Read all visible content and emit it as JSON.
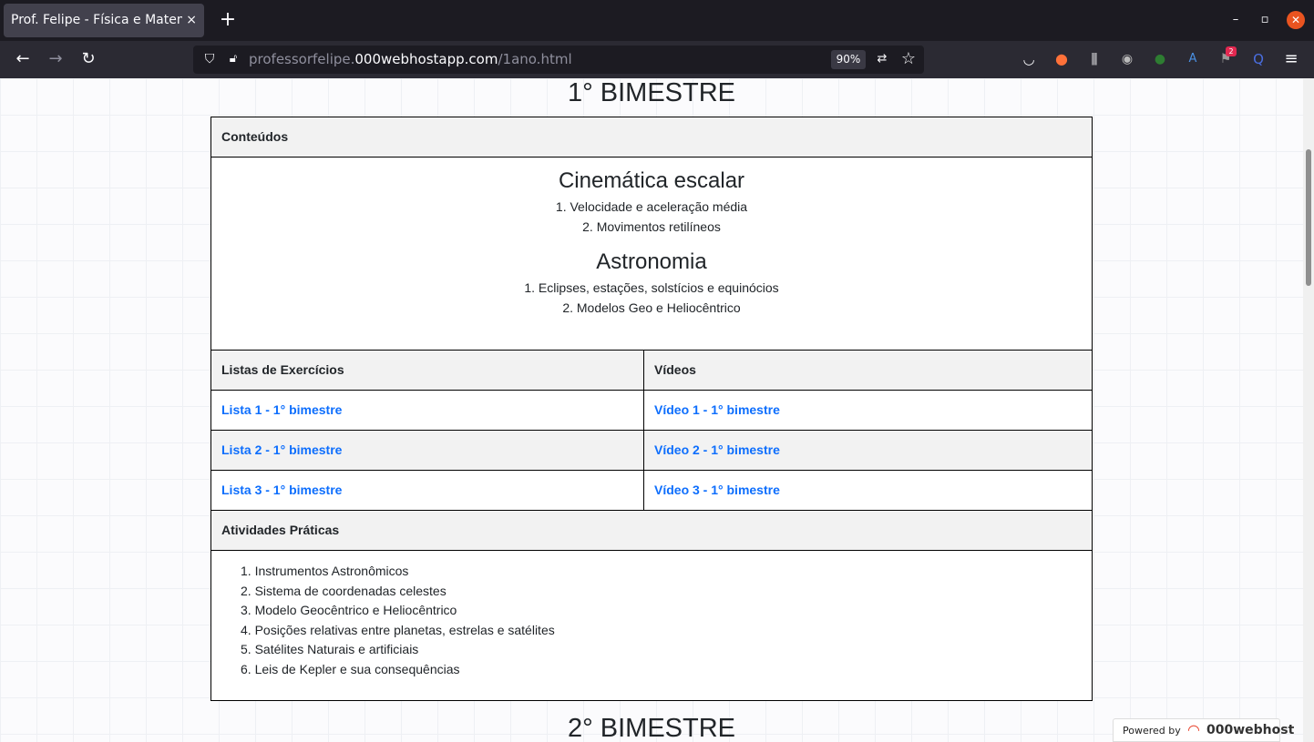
{
  "browser": {
    "tab_title": "Prof. Felipe - Física e Matemática",
    "tab_close": "×",
    "new_tab": "+",
    "window_controls": {
      "minimize": "–",
      "maximize": "▫",
      "close": "✕"
    },
    "url_scheme": "professorfelipe.",
    "url_host": "000webhostapp.com",
    "url_path": "/1ano.html",
    "zoom": "90%",
    "notification_badge": "2"
  },
  "page": {
    "bimester1_title": "1° BIMESTRE",
    "contents_header": "Conteúdos",
    "topic1_title": "Cinemática escalar",
    "topic1_items": [
      "1. Velocidade e aceleração média",
      "2. Movimentos retilíneos"
    ],
    "topic2_title": "Astronomia",
    "topic2_items": [
      "1. Eclipses, estações, solstícios e equinócios",
      "2. Modelos Geo e Heliocêntrico"
    ],
    "lists_header": "Listas de Exercícios",
    "videos_header": "Vídeos",
    "lists": [
      "Lista 1 - 1° bimestre",
      "Lista 2 - 1° bimestre",
      "Lista 3 - 1° bimestre"
    ],
    "videos": [
      "Vídeo 1 - 1° bimestre",
      "Vídeo 2 - 1° bimestre",
      "Vídeo 3 - 1° bimestre"
    ],
    "practical_header": "Atividades Práticas",
    "practical_items": [
      "1. Instrumentos Astronômicos",
      "2. Sistema de coordenadas celestes",
      "3. Modelo Geocêntrico e Heliocêntrico",
      "4. Posições relativas entre planetas, estrelas e satélites",
      "5. Satélites Naturais e artificiais",
      "6. Leis de Kepler e sua consequências"
    ],
    "bimester2_title": "2° BIMESTRE"
  },
  "footer": {
    "powered_by": "Powered by",
    "brand": "000webhost"
  },
  "icons": {
    "back": "back-arrow-icon",
    "forward": "forward-arrow-icon",
    "reload": "reload-icon",
    "shield": "tracking-shield-icon",
    "lock": "insecure-lock-icon",
    "translate": "translate-icon",
    "bookmark": "bookmark-star-icon",
    "pocket": "pocket-icon",
    "library": "library-icon",
    "menu": "hamburger-menu-icon"
  },
  "colors": {
    "link": "#0d6efd",
    "header_bg": "#f2f2f2",
    "chrome_dark": "#1c1b22",
    "accent_close": "#e95420"
  }
}
